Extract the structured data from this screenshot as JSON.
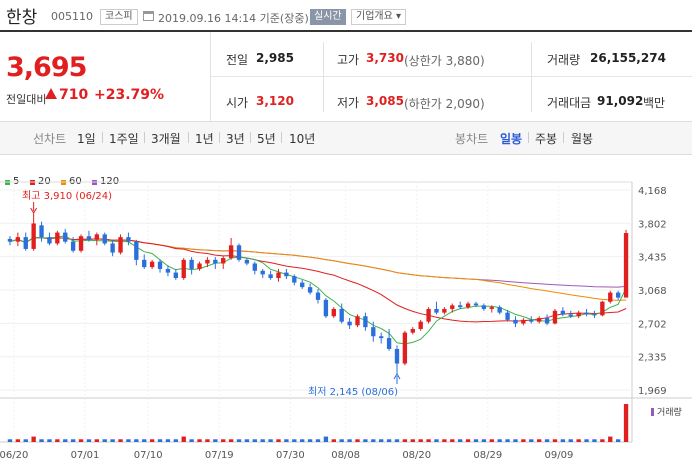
{
  "header": {
    "stock_name": "한창",
    "stock_code": "005110",
    "market_badge": "코스피",
    "datetime": "2019.09.16 14:14 기준(장중)",
    "realtime_label": "실시간",
    "company_info_label": "기업개요 ▾"
  },
  "price": {
    "current": "3,695",
    "change_label": "전일대비",
    "change_amount": "710",
    "change_pct": "+23.79%"
  },
  "stats": {
    "prev_close_label": "전일",
    "prev_close": "2,985",
    "open_label": "시가",
    "open": "3,120",
    "high_label": "고가",
    "high": "3,730",
    "high_limit": "(상한가 3,880)",
    "low_label": "저가",
    "low": "3,085",
    "low_limit": "(하한가 2,090)",
    "volume_label": "거래량",
    "volume": "26,155,274",
    "value_label": "거래대금",
    "value": "91,092",
    "value_unit": "백만"
  },
  "period_bar": {
    "line_chart_label": "선차트",
    "periods": [
      "1일",
      "1주일",
      "3개월",
      "1년",
      "3년",
      "5년",
      "10년"
    ],
    "candle_label": "봉차트",
    "candle_types": [
      "일봉",
      "주봉",
      "월봉"
    ]
  },
  "colors": {
    "up": "#e02020",
    "down": "#2a6fdb",
    "ma5": "#3cb44b",
    "ma20": "#e02020",
    "ma60": "#f08c00",
    "ma120": "#9b59b6"
  },
  "chart_data": {
    "type": "candlestick",
    "legend": [
      "5",
      "20",
      "60",
      "120"
    ],
    "y_ticks": [
      "4,168",
      "3,802",
      "3,435",
      "3,068",
      "2,702",
      "2,335",
      "1,969"
    ],
    "ylim": [
      1969,
      4168
    ],
    "x_ticks": [
      "06/20",
      "07/01",
      "07/10",
      "07/19",
      "07/30",
      "08/08",
      "08/20",
      "08/29",
      "09/09"
    ],
    "annotations": {
      "high": "최고 3,910 (06/24)",
      "low": "최저 2,145 (08/06)"
    },
    "volume_label": "거래량",
    "candles": [
      [
        3630,
        3660,
        3560,
        3600
      ],
      [
        3600,
        3700,
        3550,
        3650
      ],
      [
        3650,
        3700,
        3500,
        3520
      ],
      [
        3520,
        3910,
        3500,
        3800
      ],
      [
        3780,
        3820,
        3600,
        3650
      ],
      [
        3650,
        3700,
        3560,
        3580
      ],
      [
        3580,
        3720,
        3560,
        3700
      ],
      [
        3700,
        3740,
        3580,
        3600
      ],
      [
        3600,
        3650,
        3480,
        3500
      ],
      [
        3500,
        3680,
        3480,
        3660
      ],
      [
        3660,
        3720,
        3600,
        3620
      ],
      [
        3620,
        3700,
        3560,
        3680
      ],
      [
        3680,
        3700,
        3560,
        3580
      ],
      [
        3580,
        3620,
        3440,
        3480
      ],
      [
        3480,
        3680,
        3460,
        3650
      ],
      [
        3650,
        3700,
        3560,
        3600
      ],
      [
        3600,
        3620,
        3340,
        3400
      ],
      [
        3400,
        3460,
        3300,
        3320
      ],
      [
        3320,
        3400,
        3300,
        3380
      ],
      [
        3380,
        3400,
        3260,
        3300
      ],
      [
        3300,
        3340,
        3220,
        3260
      ],
      [
        3260,
        3300,
        3180,
        3200
      ],
      [
        3200,
        3420,
        3180,
        3400
      ],
      [
        3400,
        3430,
        3240,
        3300
      ],
      [
        3300,
        3380,
        3280,
        3360
      ],
      [
        3360,
        3430,
        3320,
        3400
      ],
      [
        3400,
        3430,
        3300,
        3360
      ],
      [
        3360,
        3440,
        3300,
        3420
      ],
      [
        3420,
        3640,
        3400,
        3560
      ],
      [
        3560,
        3580,
        3380,
        3400
      ],
      [
        3400,
        3420,
        3340,
        3360
      ],
      [
        3360,
        3380,
        3240,
        3280
      ],
      [
        3280,
        3300,
        3200,
        3240
      ],
      [
        3240,
        3280,
        3180,
        3200
      ],
      [
        3200,
        3300,
        3160,
        3260
      ],
      [
        3260,
        3300,
        3190,
        3220
      ],
      [
        3220,
        3240,
        3120,
        3150
      ],
      [
        3150,
        3180,
        3080,
        3100
      ],
      [
        3100,
        3140,
        3020,
        3040
      ],
      [
        3040,
        3080,
        2920,
        2960
      ],
      [
        2960,
        2980,
        2760,
        2780
      ],
      [
        2780,
        2880,
        2760,
        2860
      ],
      [
        2860,
        2920,
        2700,
        2720
      ],
      [
        2720,
        2760,
        2640,
        2680
      ],
      [
        2680,
        2800,
        2660,
        2780
      ],
      [
        2780,
        2820,
        2620,
        2660
      ],
      [
        2660,
        2720,
        2500,
        2560
      ],
      [
        2560,
        2600,
        2480,
        2540
      ],
      [
        2540,
        2640,
        2400,
        2420
      ],
      [
        2420,
        2460,
        2145,
        2260
      ],
      [
        2260,
        2620,
        2240,
        2600
      ],
      [
        2600,
        2660,
        2580,
        2640
      ],
      [
        2640,
        2740,
        2620,
        2720
      ],
      [
        2720,
        2880,
        2700,
        2860
      ],
      [
        2860,
        2940,
        2800,
        2820
      ],
      [
        2820,
        2880,
        2800,
        2860
      ],
      [
        2860,
        2920,
        2820,
        2900
      ],
      [
        2900,
        2940,
        2860,
        2880
      ],
      [
        2880,
        2940,
        2860,
        2920
      ],
      [
        2920,
        2940,
        2880,
        2900
      ],
      [
        2900,
        2920,
        2840,
        2860
      ],
      [
        2860,
        2900,
        2820,
        2880
      ],
      [
        2880,
        2900,
        2800,
        2820
      ],
      [
        2820,
        2850,
        2720,
        2740
      ],
      [
        2740,
        2780,
        2660,
        2700
      ],
      [
        2700,
        2760,
        2680,
        2740
      ],
      [
        2740,
        2780,
        2700,
        2720
      ],
      [
        2720,
        2780,
        2700,
        2760
      ],
      [
        2760,
        2800,
        2680,
        2700
      ],
      [
        2700,
        2860,
        2690,
        2840
      ],
      [
        2840,
        2880,
        2780,
        2800
      ],
      [
        2800,
        2840,
        2760,
        2780
      ],
      [
        2780,
        2840,
        2760,
        2820
      ],
      [
        2820,
        2860,
        2780,
        2800
      ],
      [
        2800,
        2840,
        2760,
        2790
      ],
      [
        2790,
        2950,
        2780,
        2940
      ],
      [
        2940,
        3060,
        2920,
        3040
      ],
      [
        3040,
        3060,
        2960,
        2985
      ],
      [
        2985,
        3730,
        3085,
        3695
      ]
    ],
    "volume": [
      1,
      1,
      1,
      2,
      1,
      1,
      1,
      1,
      1,
      1,
      1,
      1,
      1,
      1,
      1,
      1,
      1,
      1,
      1,
      1,
      1,
      1,
      2,
      1,
      1,
      1,
      1,
      1,
      1,
      1,
      1,
      1,
      1,
      1,
      1,
      1,
      1,
      1,
      1,
      1,
      2,
      1,
      1,
      1,
      1,
      1,
      1,
      1,
      1,
      1,
      1,
      1,
      1,
      1,
      1,
      1,
      1,
      1,
      1,
      1,
      1,
      1,
      1,
      1,
      1,
      1,
      1,
      1,
      1,
      1,
      1,
      1,
      1,
      1,
      1,
      1,
      2,
      1,
      14
    ]
  }
}
